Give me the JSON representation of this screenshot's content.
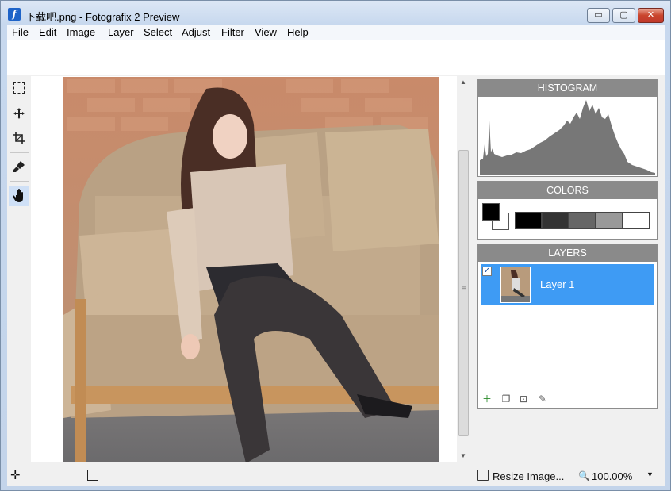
{
  "window": {
    "title": "下载吧.png - Fotografix 2 Preview",
    "controls": {
      "minimize": "▭",
      "maximize": "▢",
      "close": "✕"
    }
  },
  "menu": [
    "File",
    "Edit",
    "Image",
    "Layer",
    "Select",
    "Adjust",
    "Filter",
    "View",
    "Help"
  ],
  "tools": [
    {
      "name": "rect-select-icon"
    },
    {
      "name": "move-icon"
    },
    {
      "name": "crop-icon"
    },
    {
      "name": "brush-icon"
    },
    {
      "name": "hand-icon",
      "active": true
    }
  ],
  "panels": {
    "histogram": {
      "title": "HISTOGRAM"
    },
    "colors": {
      "title": "COLORS",
      "foreground": "#000000",
      "background": "#ffffff",
      "palette": [
        "#000000",
        "#333333",
        "#666666",
        "#999999",
        "#ffffff"
      ]
    },
    "layers": {
      "title": "LAYERS",
      "items": [
        {
          "name": "Layer 1",
          "visible": true,
          "selected": true
        }
      ]
    }
  },
  "status": {
    "resize_label": "Resize Image...",
    "zoom": "100.00%"
  },
  "colors": {
    "selection": "#3e9bf4",
    "panel_header": "#8a8a8a"
  }
}
